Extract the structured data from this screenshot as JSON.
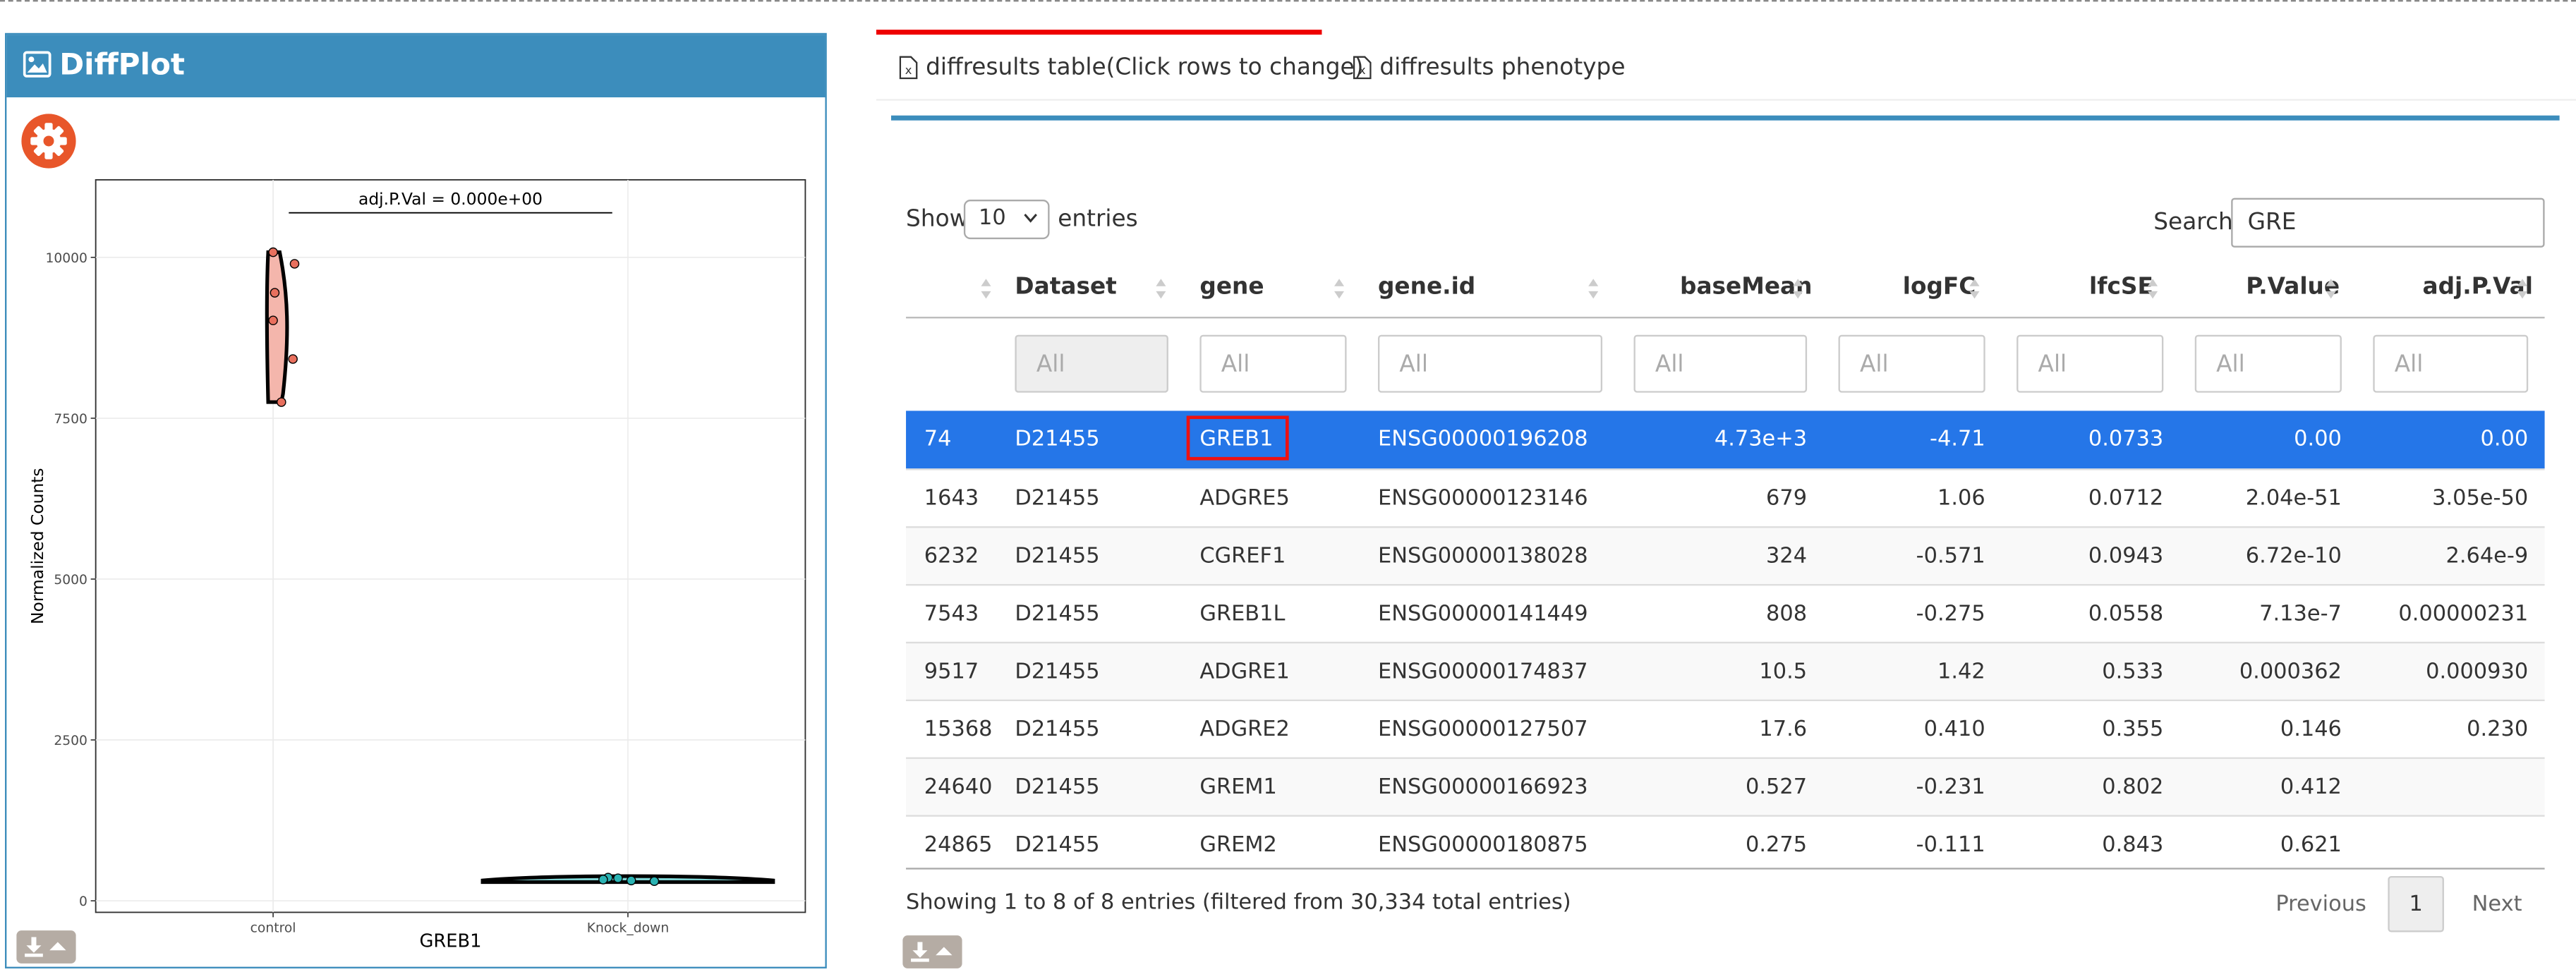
{
  "box": {
    "title": "DiffPlot"
  },
  "tabs": [
    {
      "label": "diffresults table(Click rows to change)",
      "active": true
    },
    {
      "label": "diffresults phenotype",
      "active": false
    }
  ],
  "controls": {
    "show_label": "Show",
    "page_length": "10",
    "entries_label": "entries",
    "search_label": "Search:",
    "search_value": "GRE"
  },
  "table": {
    "columns": [
      "",
      "Dataset",
      "gene",
      "gene.id",
      "baseMean",
      "logFC",
      "lfcSE",
      "P.Value",
      "adj.P.Val"
    ],
    "filter_placeholder": "All",
    "rows": [
      {
        "id": "74",
        "dataset": "D21455",
        "gene": "GREB1",
        "gene_id": "ENSG00000196208",
        "baseMean": "4.73e+3",
        "logFC": "-4.71",
        "lfcSE": "0.0733",
        "pvalue": "0.00",
        "adjp": "0.00",
        "selected": true
      },
      {
        "id": "1643",
        "dataset": "D21455",
        "gene": "ADGRE5",
        "gene_id": "ENSG00000123146",
        "baseMean": "679",
        "logFC": "1.06",
        "lfcSE": "0.0712",
        "pvalue": "2.04e-51",
        "adjp": "3.05e-50"
      },
      {
        "id": "6232",
        "dataset": "D21455",
        "gene": "CGREF1",
        "gene_id": "ENSG00000138028",
        "baseMean": "324",
        "logFC": "-0.571",
        "lfcSE": "0.0943",
        "pvalue": "6.72e-10",
        "adjp": "2.64e-9"
      },
      {
        "id": "7543",
        "dataset": "D21455",
        "gene": "GREB1L",
        "gene_id": "ENSG00000141449",
        "baseMean": "808",
        "logFC": "-0.275",
        "lfcSE": "0.0558",
        "pvalue": "7.13e-7",
        "adjp": "0.00000231"
      },
      {
        "id": "9517",
        "dataset": "D21455",
        "gene": "ADGRE1",
        "gene_id": "ENSG00000174837",
        "baseMean": "10.5",
        "logFC": "1.42",
        "lfcSE": "0.533",
        "pvalue": "0.000362",
        "adjp": "0.000930"
      },
      {
        "id": "15368",
        "dataset": "D21455",
        "gene": "ADGRE2",
        "gene_id": "ENSG00000127507",
        "baseMean": "17.6",
        "logFC": "0.410",
        "lfcSE": "0.355",
        "pvalue": "0.146",
        "adjp": "0.230"
      },
      {
        "id": "24640",
        "dataset": "D21455",
        "gene": "GREM1",
        "gene_id": "ENSG00000166923",
        "baseMean": "0.527",
        "logFC": "-0.231",
        "lfcSE": "0.802",
        "pvalue": "0.412",
        "adjp": ""
      },
      {
        "id": "24865",
        "dataset": "D21455",
        "gene": "GREM2",
        "gene_id": "ENSG00000180875",
        "baseMean": "0.275",
        "logFC": "-0.111",
        "lfcSE": "0.843",
        "pvalue": "0.621",
        "adjp": ""
      }
    ],
    "info": "Showing 1 to 8 of 8 entries (filtered from 30,334 total entries)"
  },
  "pager": {
    "previous": "Previous",
    "current": "1",
    "next": "Next"
  },
  "colors": {
    "box_header": "#3c8dbc",
    "selected_row": "#2576e8",
    "gear_button": "#e8562a",
    "control_fill": "#f4b6ac",
    "knockdown_fill": "#7fd3d3"
  },
  "chart_data": {
    "type": "violin",
    "title": "",
    "xlabel": "GREB1",
    "ylabel": "Normalized Counts",
    "categories": [
      "control",
      "Knock_down"
    ],
    "ylim": [
      0,
      10800
    ],
    "yticks": [
      0,
      2500,
      5000,
      7500,
      10000
    ],
    "annotation": "adj.P.Val = 0.000e+00",
    "points": {
      "control": [
        10080,
        9900,
        9450,
        9020,
        8420,
        7750
      ],
      "Knock_down": [
        360,
        330,
        315,
        305,
        350
      ]
    },
    "violin_range": {
      "control": [
        7750,
        10080
      ],
      "Knock_down": [
        290,
        380
      ]
    }
  }
}
